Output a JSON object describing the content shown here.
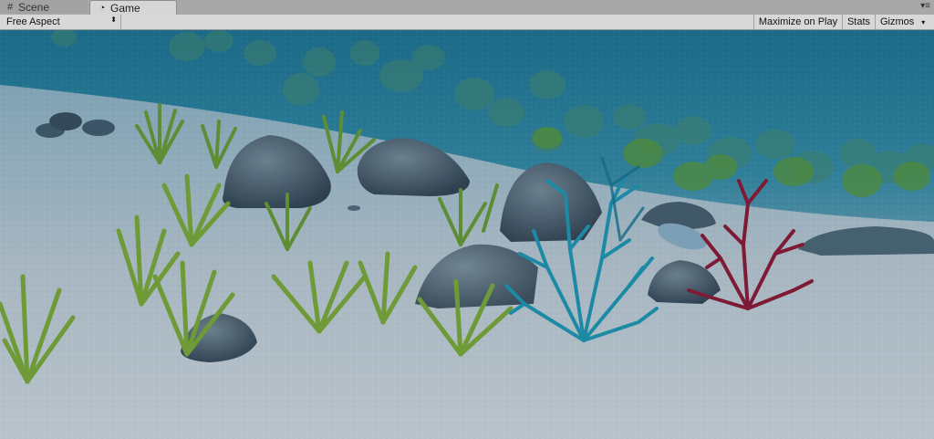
{
  "tabs": [
    {
      "label": "Scene",
      "icon": "grid-icon",
      "active": false
    },
    {
      "label": "Game",
      "icon": "pacman-icon",
      "active": true
    }
  ],
  "toolbar": {
    "aspect_value": "Free Aspect",
    "maximize_label": "Maximize on Play",
    "stats_label": "Stats",
    "gizmos_label": "Gizmos"
  },
  "colors": {
    "water_top": "#1e6f8c",
    "sand": "#a9b7c1",
    "grass": "#5f8f2a",
    "coral_blue": "#1f8fa8",
    "coral_red": "#8a1f3a",
    "rock": "#3f5566"
  }
}
